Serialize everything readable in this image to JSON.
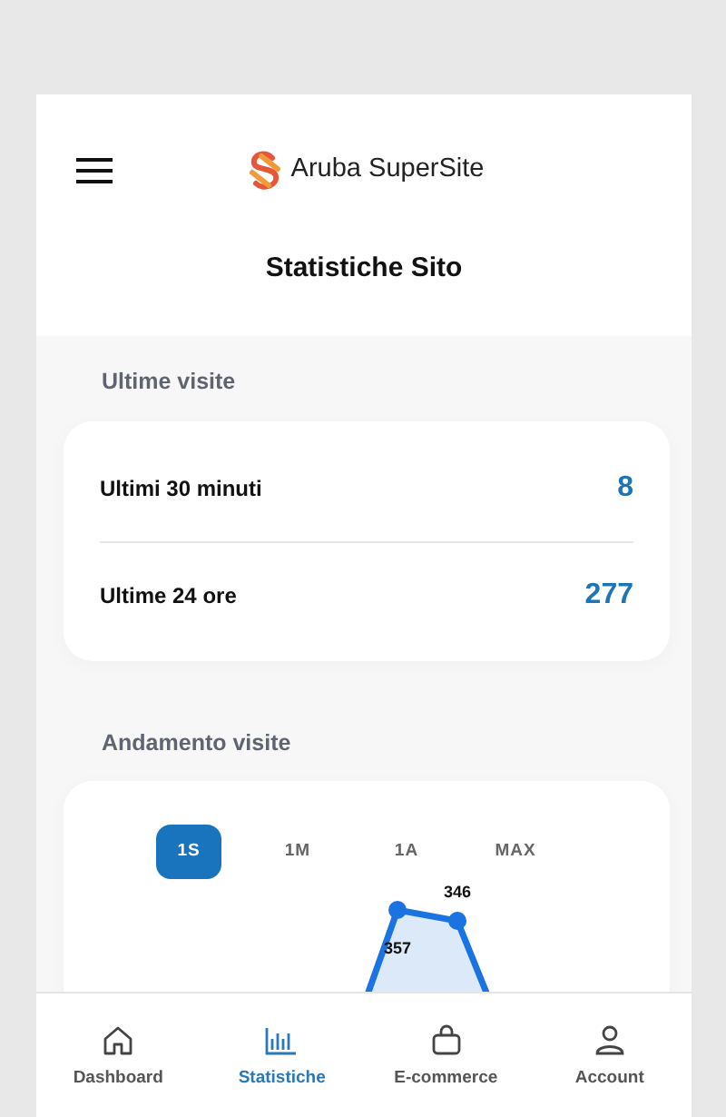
{
  "header": {
    "brand": "Aruba SuperSite"
  },
  "page_title": "Statistiche Sito",
  "recent_visits": {
    "heading": "Ultime visite",
    "rows": [
      {
        "label": "Ultimi 30 minuti",
        "value": "8"
      },
      {
        "label": "Ultime 24 ore",
        "value": "277"
      }
    ]
  },
  "trend": {
    "heading": "Andamento visite",
    "ranges": [
      {
        "label": "1S",
        "selected": true
      },
      {
        "label": "1M",
        "selected": false
      },
      {
        "label": "1A",
        "selected": false
      },
      {
        "label": "MAX",
        "selected": false
      }
    ],
    "point_labels": [
      "357",
      "346"
    ]
  },
  "bottom_nav": [
    {
      "label": "Dashboard",
      "selected": false
    },
    {
      "label": "Statistiche",
      "selected": true
    },
    {
      "label": "E-commerce",
      "selected": false
    },
    {
      "label": "Account",
      "selected": false
    }
  ]
}
